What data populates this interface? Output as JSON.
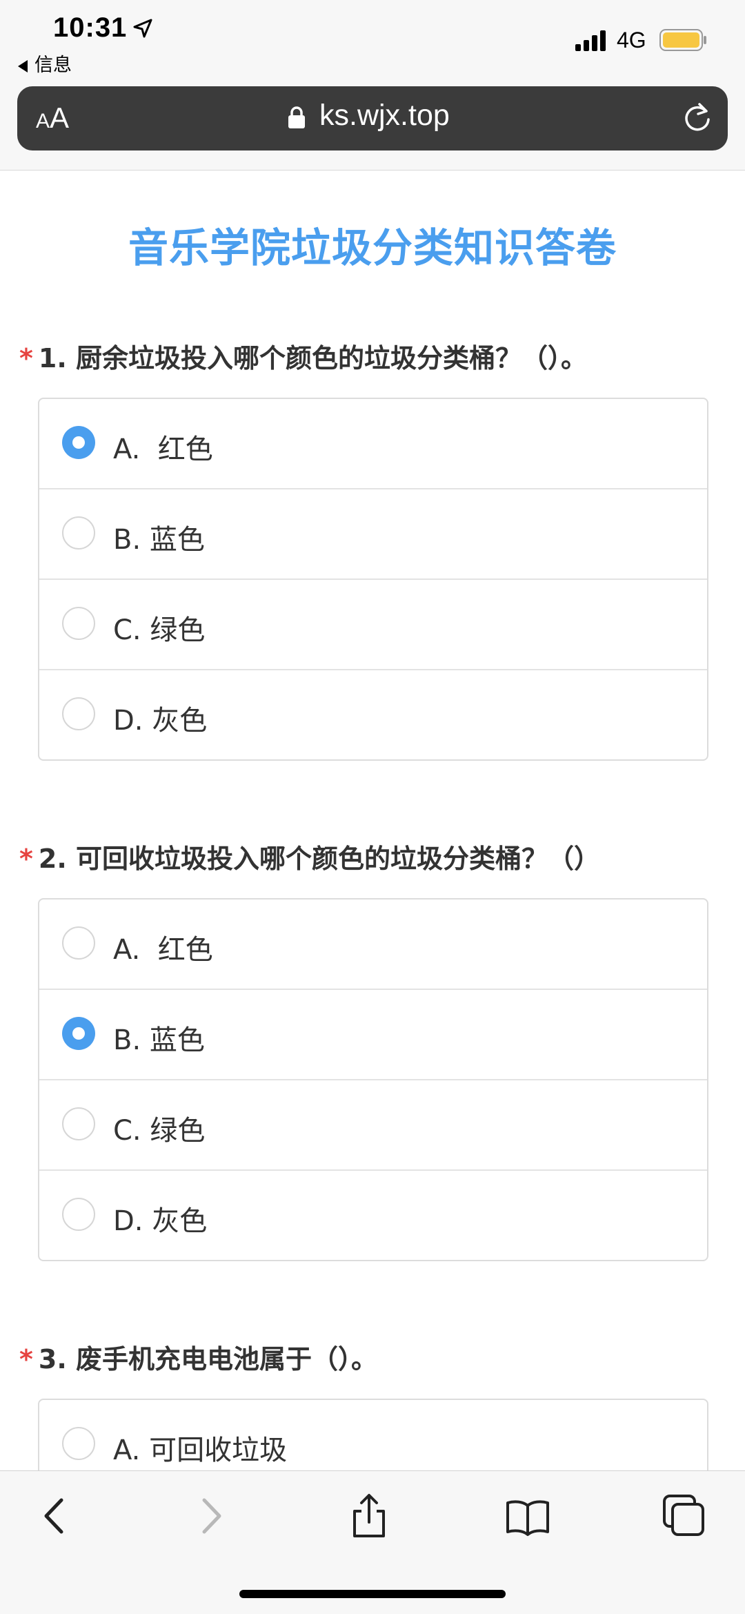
{
  "status_bar": {
    "time": "10:31",
    "back_app": "信息",
    "network": "4G",
    "battery_color": "#f7c742",
    "location_icon": "location-arrow-icon",
    "signal_icon": "signal-bars-icon",
    "battery_icon": "battery-icon"
  },
  "url_bar": {
    "text_size_small": "A",
    "text_size_large": "A",
    "url": "ks.wjx.top",
    "lock_icon": "lock-icon",
    "reload_icon": "reload-icon"
  },
  "page": {
    "title": "音乐学院垃圾分类知识答卷",
    "accent_color": "#4a9eee",
    "required_color": "#e64340"
  },
  "questions": [
    {
      "required": "*",
      "title": "1. 厨余垃圾投入哪个颜色的垃圾分类桶？（）。",
      "options": [
        {
          "label": "A.  红色",
          "selected": true
        },
        {
          "label": "B. 蓝色",
          "selected": false
        },
        {
          "label": "C. 绿色",
          "selected": false
        },
        {
          "label": "D. 灰色",
          "selected": false
        }
      ]
    },
    {
      "required": "*",
      "title": "2. 可回收垃圾投入哪个颜色的垃圾分类桶？（）",
      "options": [
        {
          "label": "A.  红色",
          "selected": false
        },
        {
          "label": "B. 蓝色",
          "selected": true
        },
        {
          "label": "C. 绿色",
          "selected": false
        },
        {
          "label": "D. 灰色",
          "selected": false
        }
      ]
    },
    {
      "required": "*",
      "title": "3. 废手机充电电池属于（）。",
      "options": [
        {
          "label": "A. 可回收垃圾",
          "selected": false
        }
      ]
    }
  ],
  "toolbar": {
    "back_icon": "chevron-left-icon",
    "forward_icon": "chevron-right-icon",
    "share_icon": "share-icon",
    "bookmarks_icon": "book-icon",
    "tabs_icon": "tabs-icon"
  }
}
